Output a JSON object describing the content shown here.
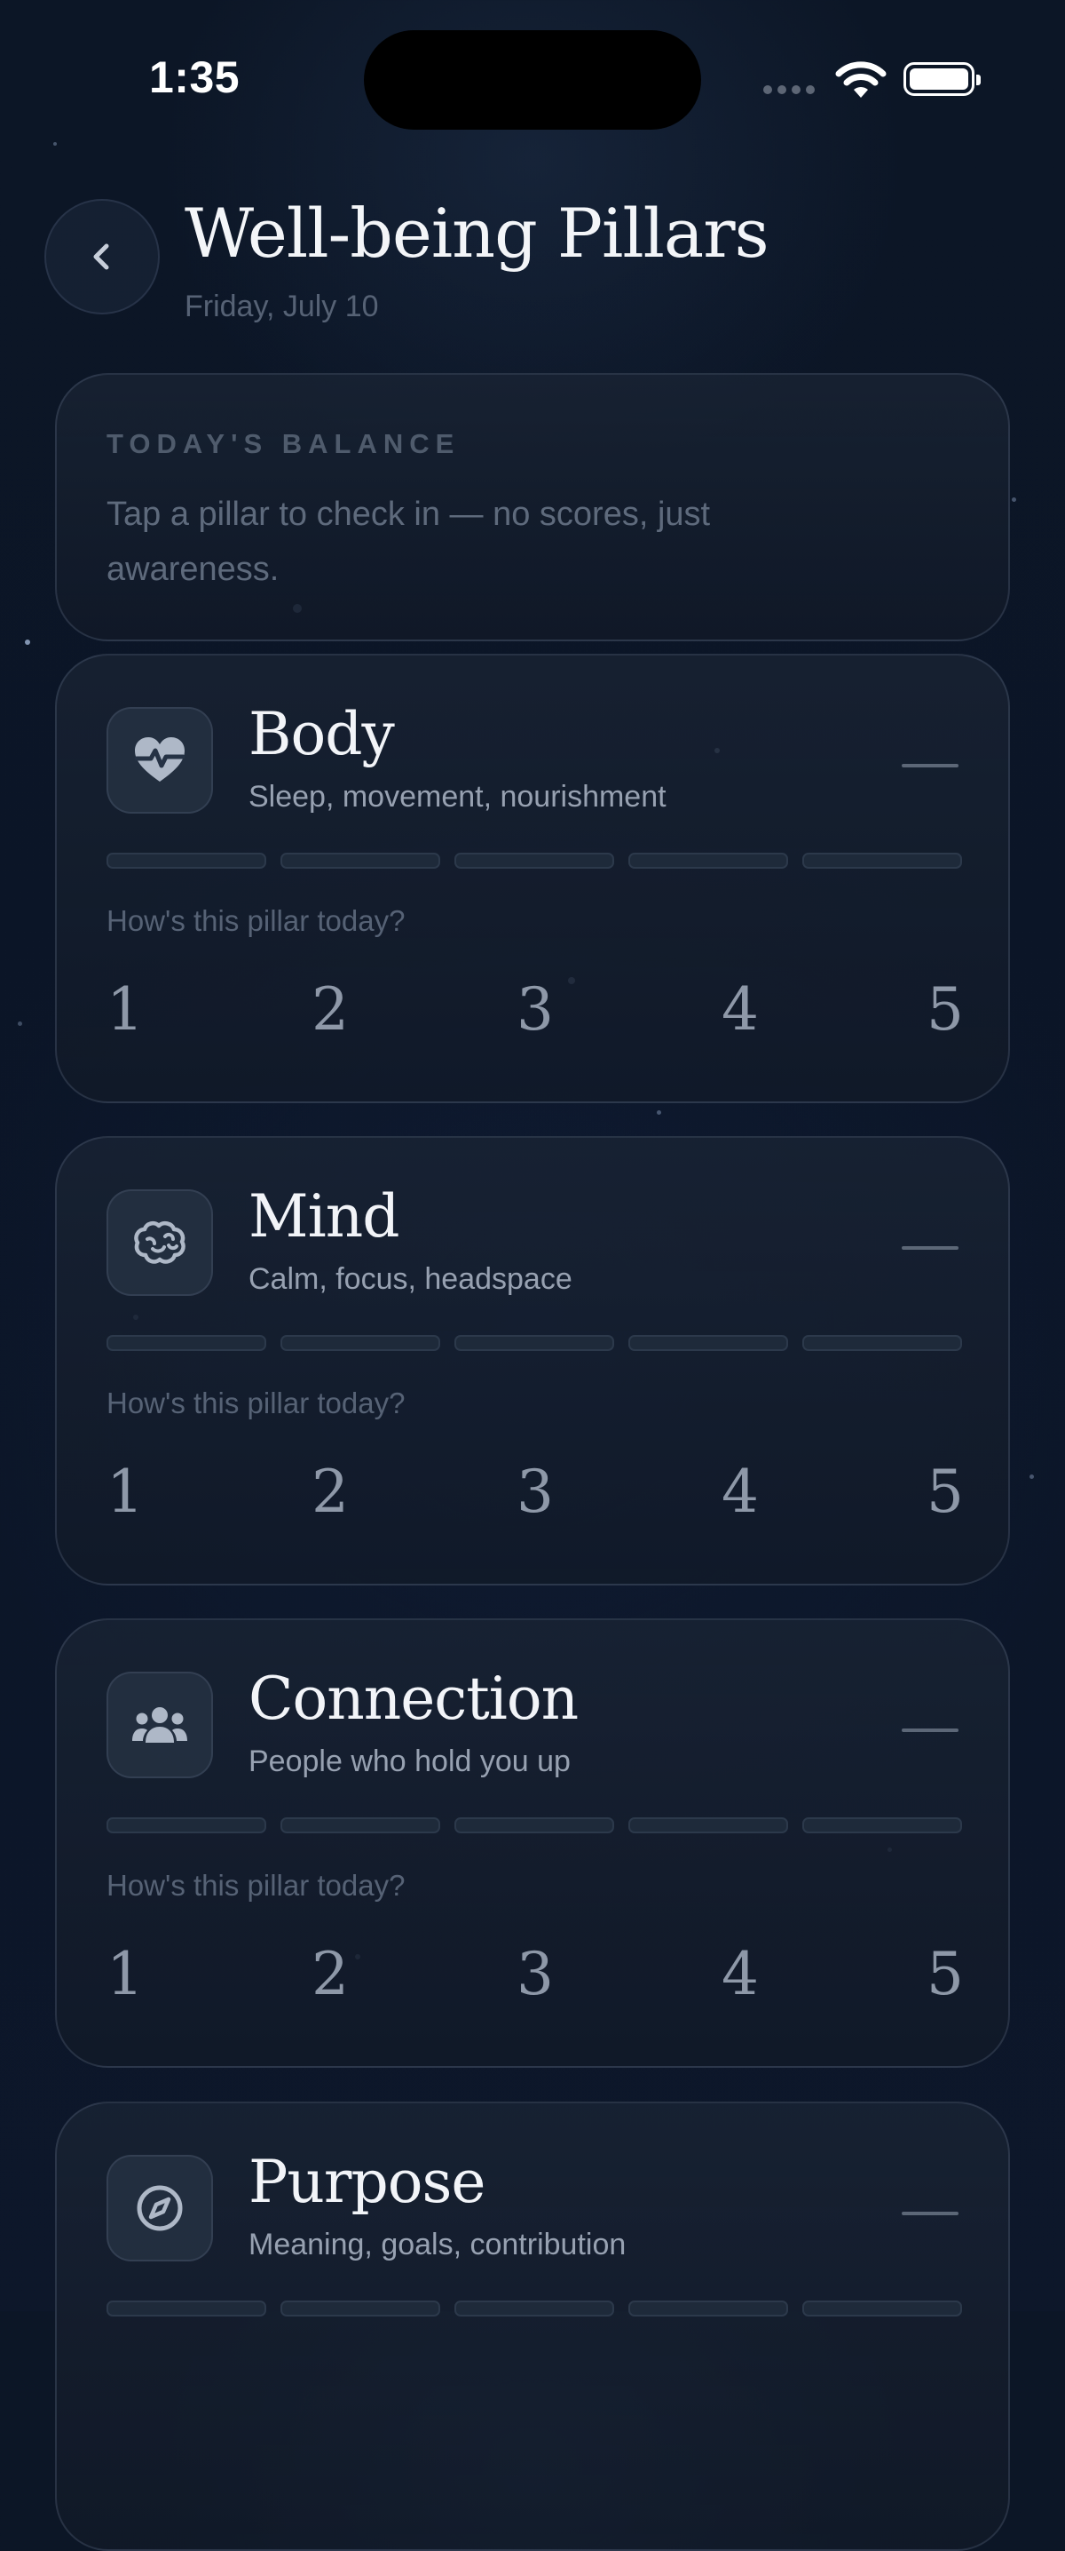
{
  "status_bar": {
    "time": "1:35"
  },
  "header": {
    "title": "Well-being Pillars",
    "date": "Friday, July 10"
  },
  "balance": {
    "kicker": "TODAY'S BALANCE",
    "hint": "Tap a pillar to check in — no scores, just awareness."
  },
  "question": "How's this pillar today?",
  "ratings": [
    "1",
    "2",
    "3",
    "4",
    "5"
  ],
  "pillars": [
    {
      "name": "Body",
      "desc": "Sleep, movement, nourishment",
      "icon": "heart-pulse-icon"
    },
    {
      "name": "Mind",
      "desc": "Calm, focus, headspace",
      "icon": "brain-icon"
    },
    {
      "name": "Connection",
      "desc": "People who hold you up",
      "icon": "people-icon"
    },
    {
      "name": "Purpose",
      "desc": "Meaning, goals, contribution",
      "icon": "compass-icon"
    }
  ],
  "colors": {
    "background": "#0b1524",
    "card_border": "#3a4558",
    "accent_text": "#f2f4f8"
  }
}
